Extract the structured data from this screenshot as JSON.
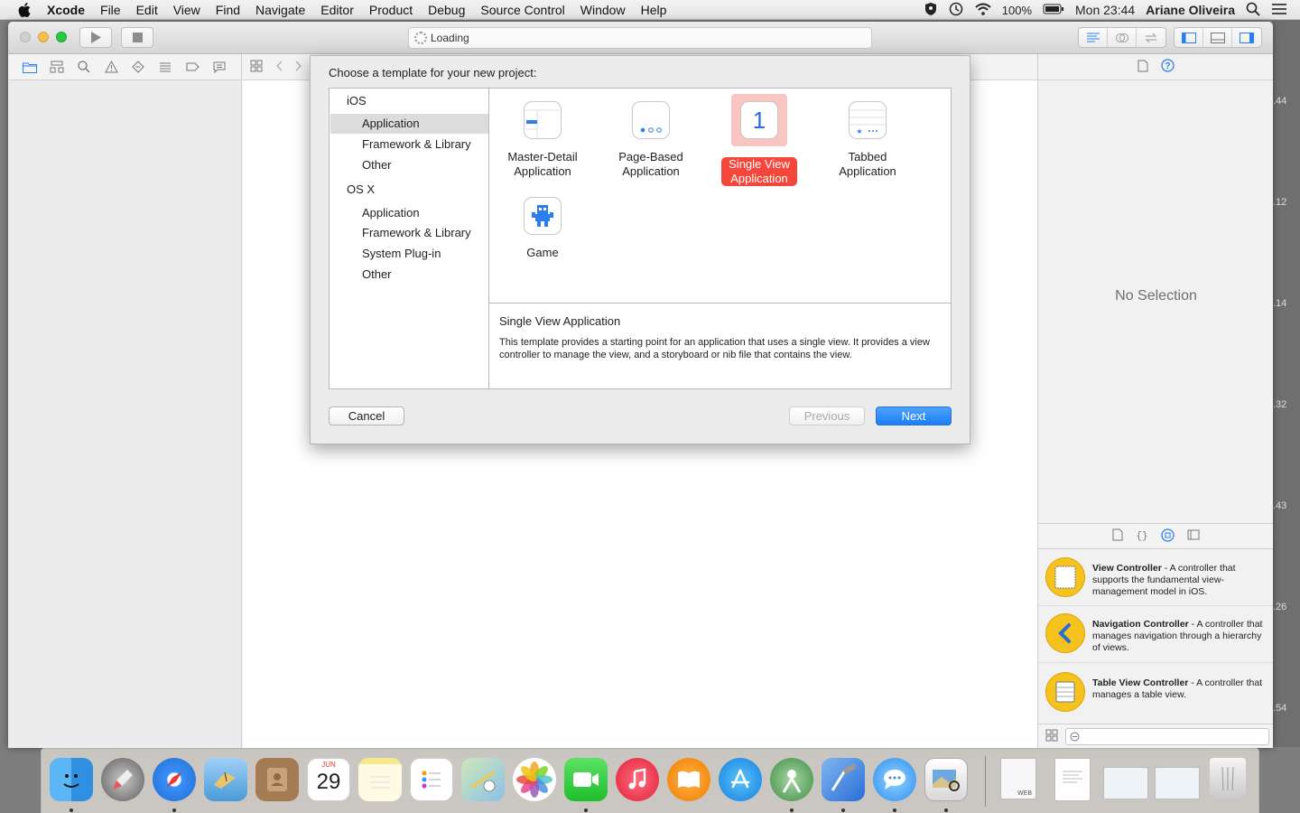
{
  "menubar": {
    "app_name": "Xcode",
    "items": [
      "File",
      "Edit",
      "View",
      "Find",
      "Navigate",
      "Editor",
      "Product",
      "Debug",
      "Source Control",
      "Window",
      "Help"
    ],
    "battery": "100%",
    "clock": "Mon 23:44",
    "user": "Ariane Oliveira"
  },
  "toolbar": {
    "activity_text": "Loading"
  },
  "desktop_labels": [
    ".44",
    ".12",
    ".14",
    ".32",
    ".43",
    ".26",
    ".54"
  ],
  "sheet": {
    "title": "Choose a template for your new project:",
    "categories": {
      "ios_label": "iOS",
      "ios_items": [
        "Application",
        "Framework & Library",
        "Other"
      ],
      "osx_label": "OS X",
      "osx_items": [
        "Application",
        "Framework & Library",
        "System Plug-in",
        "Other"
      ],
      "selected": "iOS / Application"
    },
    "templates": [
      {
        "line1": "Master-Detail",
        "line2": "Application"
      },
      {
        "line1": "Page-Based",
        "line2": "Application"
      },
      {
        "line1": "Single View",
        "line2": "Application",
        "icon_text": "1"
      },
      {
        "line1": "Tabbed",
        "line2": "Application"
      },
      {
        "line1": "Game",
        "line2": ""
      }
    ],
    "selected_template": "Single View Application",
    "description_title": "Single View Application",
    "description_body": "This template provides a starting point for an application that uses a single view. It provides a view controller to manage the view, and a storyboard or nib file that contains the view.",
    "cancel_label": "Cancel",
    "previous_label": "Previous",
    "next_label": "Next"
  },
  "utilities": {
    "no_selection": "No Selection",
    "library": [
      {
        "name": "View Controller",
        "desc": " - A controller that supports the fundamental view-management model in iOS."
      },
      {
        "name": "Navigation Controller",
        "desc": " - A controller that manages navigation through a hierarchy of views."
      },
      {
        "name": "Table View Controller",
        "desc": " - A controller that manages a table view."
      }
    ]
  },
  "dock": {
    "calendar_month": "JUN",
    "calendar_day": "29",
    "web_label": "WEB",
    "apps": [
      "finder-icon",
      "launchpad-icon",
      "safari-icon",
      "mail-icon",
      "contacts-icon",
      "calendar-icon",
      "notes-icon",
      "reminders-icon",
      "maps-icon",
      "photos-icon",
      "facetime-icon",
      "itunes-icon",
      "ibooks-icon",
      "app-store-icon",
      "android-studio-icon",
      "xcode-icon",
      "messages-icon",
      "preview-icon",
      "web-document-icon",
      "document-stack-icon",
      "screenshot-thumbnail-icon",
      "screenshot-thumbnail-icon-2",
      "trash-icon"
    ]
  },
  "colors": {
    "accent_blue": "#1a7ef7",
    "selected_red": "#f5463c",
    "library_yellow": "#f6c21d"
  }
}
